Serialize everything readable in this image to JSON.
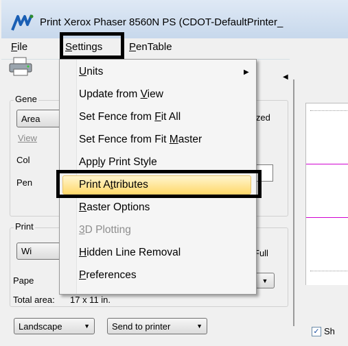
{
  "window": {
    "title": "Print  Xerox Phaser 8560N PS  (CDOT-DefaultPrinter_"
  },
  "menubar": {
    "items": [
      {
        "label": "File",
        "mnemonic": "F"
      },
      {
        "label": "Settings",
        "mnemonic": "S"
      },
      {
        "label": "PenTable",
        "mnemonic": "P"
      }
    ]
  },
  "settings_menu": {
    "items": [
      {
        "label": "Units",
        "submenu": true,
        "enabled": true
      },
      {
        "label": "Update from View",
        "enabled": true
      },
      {
        "label": "Set Fence from Fit All",
        "enabled": true
      },
      {
        "label": "Set Fence from Fit Master",
        "enabled": true
      },
      {
        "label": "Apply Print Style",
        "enabled": true
      },
      {
        "label": "Print Attributes",
        "enabled": true,
        "highlighted": true
      },
      {
        "label": "Raster Options",
        "enabled": true
      },
      {
        "label": "3D Plotting",
        "enabled": false
      },
      {
        "label": "Hidden Line Removal",
        "enabled": true
      },
      {
        "label": "Preferences",
        "enabled": true
      }
    ]
  },
  "left_panel": {
    "general_group_label": "Gene",
    "area_button": "Area",
    "sized_text": "ized",
    "view_label": "View",
    "color_label": "Col",
    "pen_label": "Pen",
    "printer_group_label": "Print",
    "windows_button": "Wi",
    "full_text": "Full",
    "paper_label": "Pape",
    "total_area_label": "Total area:",
    "total_area_value": "17 x 11 in.",
    "orientation_select": "Landscape",
    "output_select": "Send to printer"
  },
  "right_panel": {
    "show_checkbox_label": "Sh",
    "show_checked": true
  },
  "colors": {
    "highlight_top": "#fff5cf",
    "highlight_bottom": "#ffd96b",
    "preview_line": "#d000d0",
    "callout_border": "#000000"
  }
}
